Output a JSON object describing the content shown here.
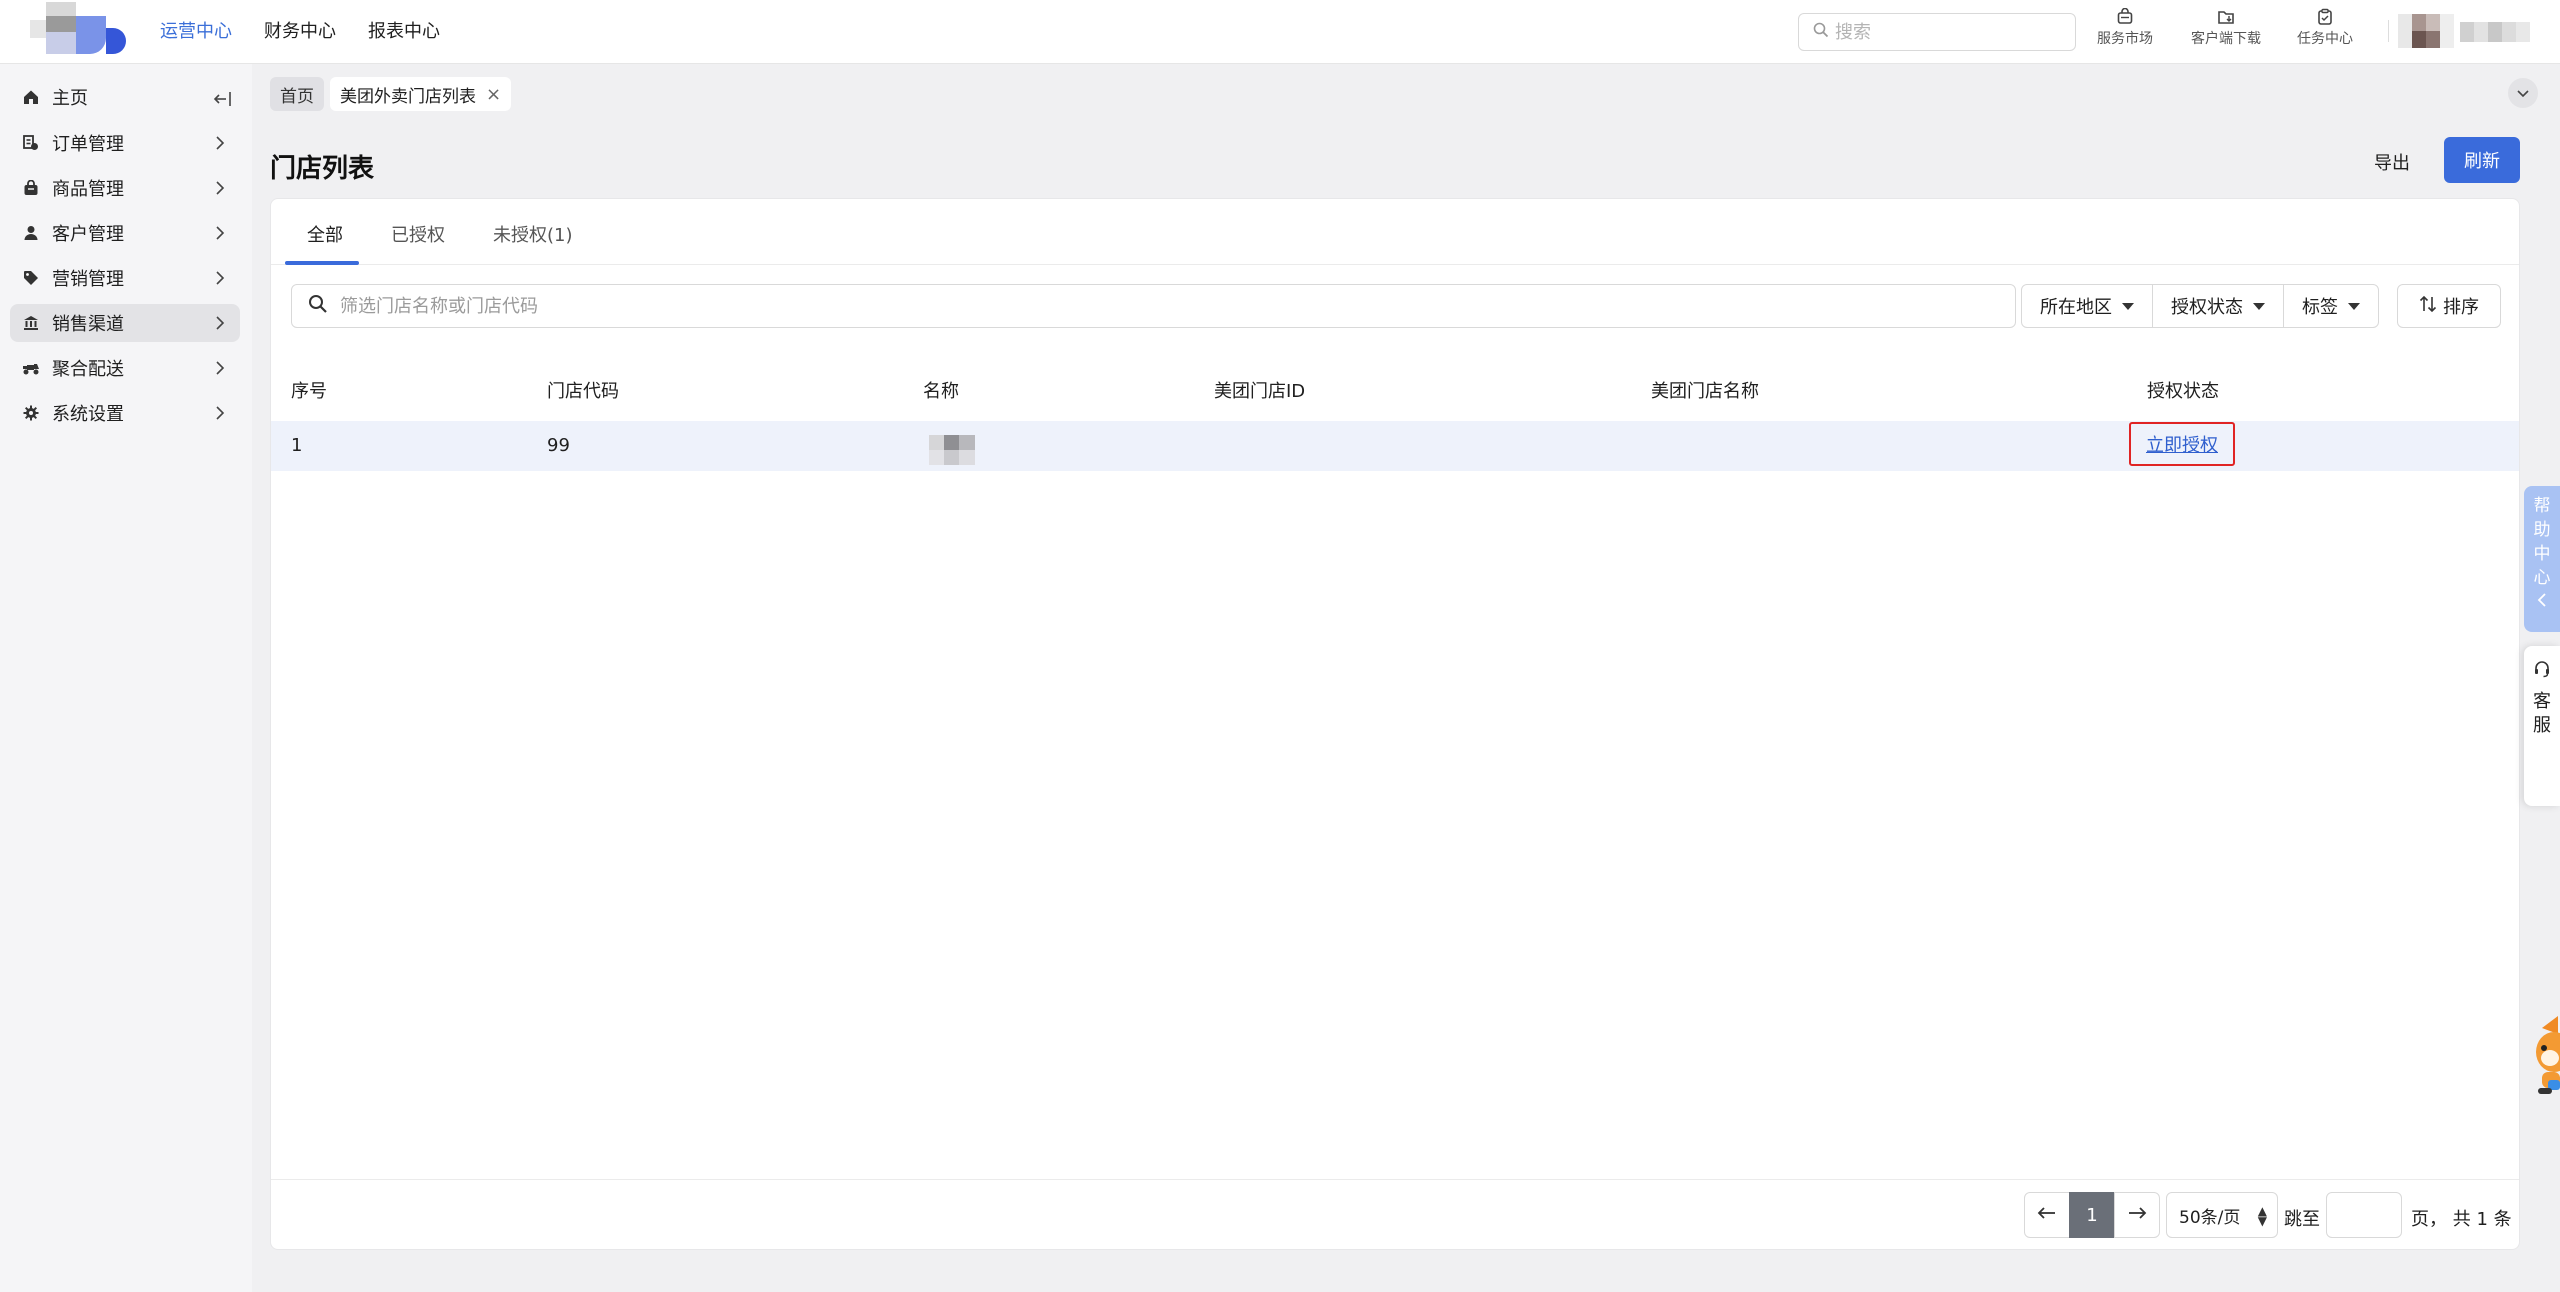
{
  "top_nav": {
    "items": [
      {
        "label": "运营中心",
        "active": true
      },
      {
        "label": "财务中心",
        "active": false
      },
      {
        "label": "报表中心",
        "active": false
      }
    ],
    "search_placeholder": "搜索",
    "tools": [
      {
        "label": "服务市场",
        "icon": "store-icon"
      },
      {
        "label": "客户端下载",
        "icon": "folder-download-icon"
      },
      {
        "label": "任务中心",
        "icon": "clipboard-icon"
      }
    ]
  },
  "sidebar": {
    "items": [
      {
        "label": "主页",
        "icon": "home-icon"
      },
      {
        "label": "订单管理",
        "icon": "order-icon"
      },
      {
        "label": "商品管理",
        "icon": "goods-icon"
      },
      {
        "label": "客户管理",
        "icon": "user-icon"
      },
      {
        "label": "营销管理",
        "icon": "tag-icon"
      },
      {
        "label": "销售渠道",
        "icon": "bank-icon",
        "active": true
      },
      {
        "label": "聚合配送",
        "icon": "scooter-icon"
      },
      {
        "label": "系统设置",
        "icon": "gear-icon"
      }
    ]
  },
  "breadcrumb": {
    "home": "首页",
    "current": "美团外卖门店列表",
    "close": "×"
  },
  "page": {
    "title": "门店列表",
    "export_label": "导出",
    "refresh_label": "刷新"
  },
  "tabs": [
    {
      "label": "全部",
      "active": true
    },
    {
      "label": "已授权",
      "active": false
    },
    {
      "label": "未授权(1)",
      "active": false
    }
  ],
  "filters": {
    "search_placeholder": "筛选门店名称或门店代码",
    "region_label": "所在地区",
    "auth_status_label": "授权状态",
    "tag_label": "标签",
    "sort_label": "排序"
  },
  "table": {
    "columns": [
      "序号",
      "门店代码",
      "名称",
      "美团门店ID",
      "美团门店名称",
      "授权状态"
    ],
    "rows": [
      {
        "index": "1",
        "code": "99",
        "name": "",
        "meituan_id": "",
        "meituan_name": "",
        "action": "立即授权"
      }
    ]
  },
  "pagination": {
    "current_page": "1",
    "page_size": "50条/页",
    "jump_label": "跳至",
    "total_label": "页， 共 1 条"
  },
  "floating": {
    "help": [
      "帮",
      "助",
      "中",
      "心"
    ],
    "service": [
      "客",
      "服"
    ]
  },
  "colors": {
    "accent": "#3a6bdb",
    "active_nav": "#3b6fd8",
    "highlight_border": "#e02424",
    "row_highlight": "#eef2fb"
  }
}
